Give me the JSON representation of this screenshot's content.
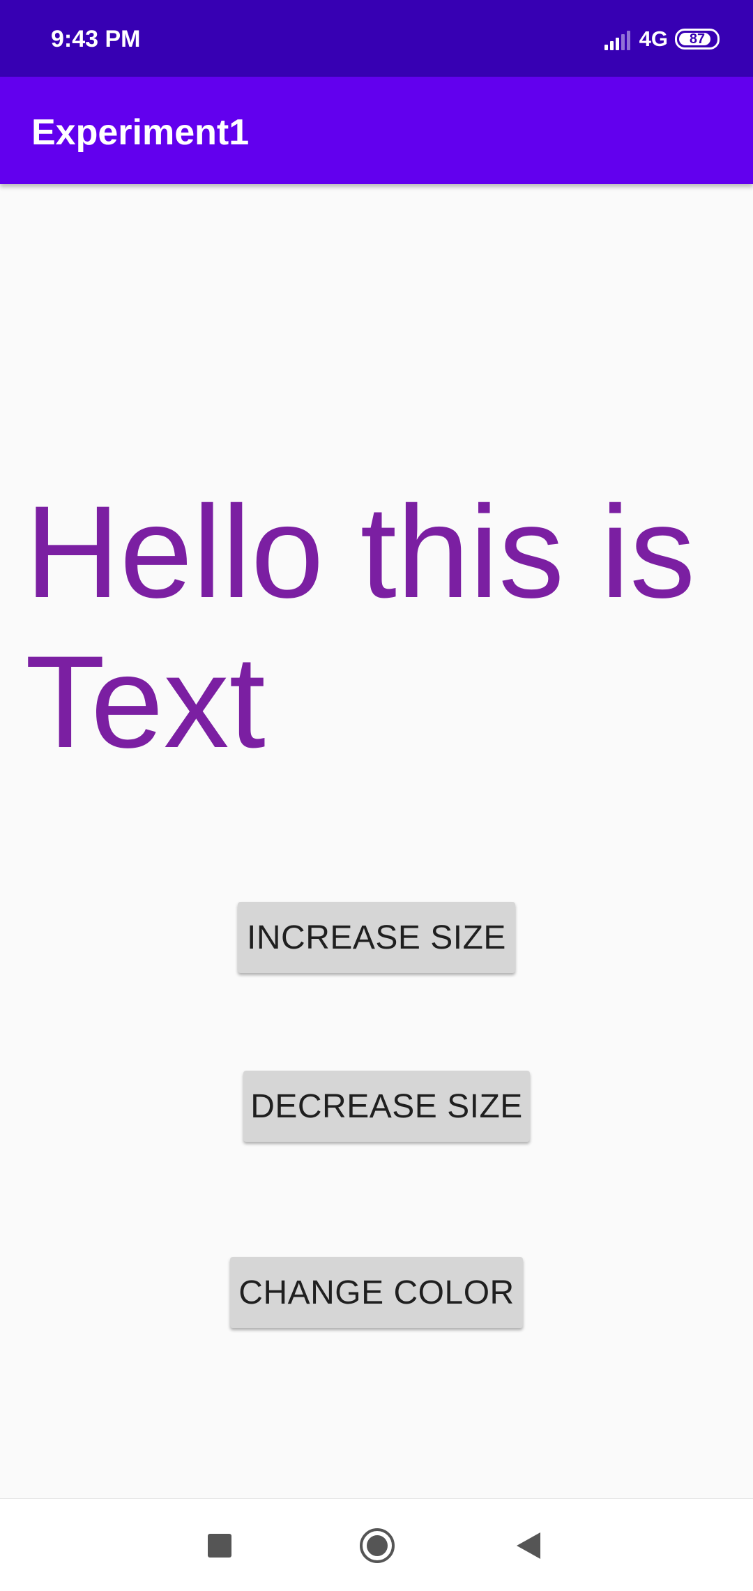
{
  "status_bar": {
    "time": "9:43 PM",
    "network": "4G",
    "battery_level": "87",
    "battery_fraction": 0.87,
    "signal_bars_total": 5,
    "signal_bars_active": 3
  },
  "app_bar": {
    "title": "Experiment1"
  },
  "main": {
    "display_text": "Hello this is Text",
    "display_text_color": "#7b1fa2"
  },
  "buttons": {
    "increase_label": "INCREASE SIZE",
    "decrease_label": "DECREASE SIZE",
    "color_label": "CHANGE COLOR"
  },
  "nav_bar": {
    "recents_icon": "square-icon",
    "home_icon": "circle-icon",
    "back_icon": "triangle-icon"
  },
  "colors": {
    "status_bar": "#3700b3",
    "primary": "#6200ee",
    "background": "#fafafa",
    "button_bg": "#d6d6d6"
  }
}
